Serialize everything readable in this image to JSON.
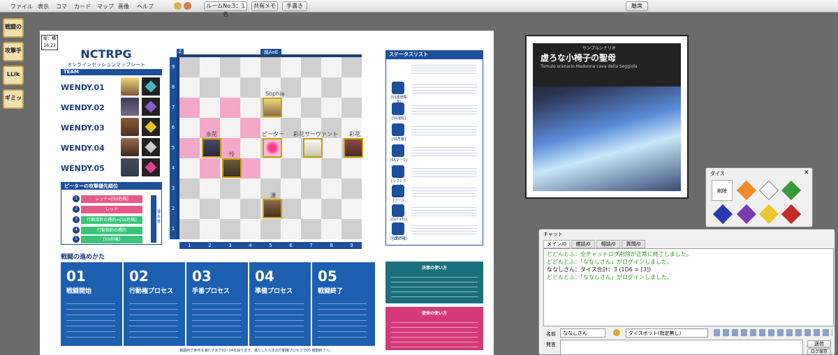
{
  "menu": [
    "ファイル",
    "表示",
    "コマ",
    "カード",
    "マップ",
    "画像",
    "ヘルプ"
  ],
  "toolbar": {
    "room": "ルームNo.3：1名",
    "memo": "共有メモ",
    "notes": "手書き",
    "away": "離席"
  },
  "side_icons": [
    "戦闘の",
    "攻撃手",
    "LLik",
    "ギミッ"
  ],
  "sheet": {
    "time": "縦：横\n16:23",
    "title": "NCTRPG",
    "subtitle": "オンラインセッションマップシート",
    "team_header": "TEAM",
    "members": [
      "WENDY.01",
      "WENDY.02",
      "WENDY.03",
      "WENDY.04",
      "WENDY.05"
    ],
    "priority_header": "ピーターの攻撃優先順位",
    "priority": [
      "レッド⇔[SS危機]",
      "レッド",
      "行動指針の標的⇔[SS危機]",
      "行動指針の標的",
      "[SS危機]"
    ],
    "priority_nums": [
      "1",
      "2",
      "3",
      "4",
      "5"
    ],
    "priority_side": "優先度",
    "grid_corner": "Z",
    "grid_top": "扇AoE",
    "col_labels": [
      "1",
      "2",
      "3",
      "4",
      "5",
      "6",
      "7",
      "8",
      "9"
    ],
    "row_labels": [
      "9",
      "8",
      "7",
      "6",
      "5",
      "4",
      "3",
      "2",
      "1"
    ],
    "pieces": {
      "sophia": "Sophia",
      "eika": "永花",
      "peter": "ピーター",
      "servant": "彩花サーヴァント",
      "ayaka": "彩花",
      "kai": "怜",
      "yu": "湧"
    },
    "status_header": "ステータスリスト",
    "status_names": [
      "[SS感覚障害]",
      "[SS混乱]",
      "[SS危機]",
      "[SSマーク]",
      "[リフレクト]",
      "[ブースト:n]",
      "[DoT:xTn]",
      "[行動不能]",
      "[ロスト]"
    ],
    "flow_header": "戦闘の進めかた",
    "steps": [
      {
        "n": "01",
        "t": "戦闘開始"
      },
      {
        "n": "02",
        "t": "行動権プロセス"
      },
      {
        "n": "03",
        "t": "手番プロセス"
      },
      {
        "n": "04",
        "t": "準備プロセス"
      },
      {
        "n": "05",
        "t": "戦闘終了"
      }
    ],
    "usage1": "決意の使い方",
    "usage2": "使命の使い方",
    "footer": "戦闘終了条件を満たすまで02~04を繰り返す。満たしたら次の行動権プロセスで05 戦闘終了へ。"
  },
  "cover": {
    "small": "サンプルシナリオ",
    "title": "虚ろな小椅子の聖母",
    "sub": "Tumulo scenario Madonna cava della Seggiola"
  },
  "dice": {
    "title": "ダイス",
    "clear": "削除",
    "close": "✕"
  },
  "chat": {
    "title": "チャット",
    "tabs": [
      "メイン/0",
      "雑談/0",
      "相談/0",
      "質問/0"
    ],
    "log": [
      {
        "text": "どどんとふ：全チャットログ削除が正常に終了しました。",
        "color": "#2a9b1a"
      },
      {
        "text": "どどんとふ：「ななしさん」がログインしました。",
        "color": "#2a9b1a"
      },
      {
        "text": "ななしさん：ダイス合計：3 (1D6 = [3])",
        "color": "#222222"
      },
      {
        "text": "どどんとふ：「ななしさん」がログインしました。",
        "color": "#2a9b1a"
      }
    ],
    "name_label": "名前",
    "name_value": "ななしさん",
    "dice_select": "ダイスボット(指定無し)",
    "say_label": "発言",
    "send": "送信",
    "save": "ログ保存"
  }
}
